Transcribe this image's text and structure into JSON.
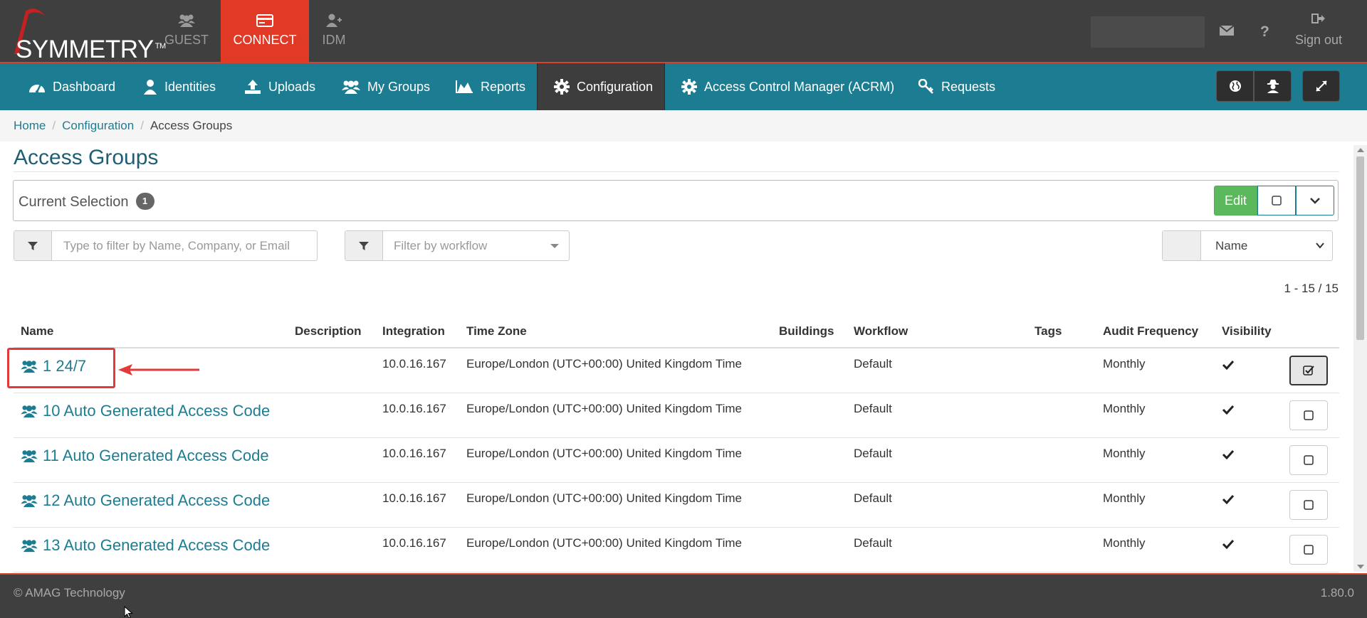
{
  "brand": {
    "name": "SYMMETRY",
    "tm": "TM"
  },
  "app_tabs": [
    {
      "label": "GUEST",
      "icon": "users-icon",
      "active": false
    },
    {
      "label": "CONNECT",
      "icon": "id-card-icon",
      "active": true
    },
    {
      "label": "IDM",
      "icon": "user-plus-icon",
      "active": false
    }
  ],
  "topbar": {
    "sign_out": "Sign out"
  },
  "nav": {
    "items": [
      {
        "label": "Dashboard",
        "icon": "tachometer-icon"
      },
      {
        "label": "Identities",
        "icon": "user-icon"
      },
      {
        "label": "Uploads",
        "icon": "upload-icon"
      },
      {
        "label": "My Groups",
        "icon": "users-icon"
      },
      {
        "label": "Reports",
        "icon": "area-chart-icon"
      },
      {
        "label": "Configuration",
        "icon": "gear-icon",
        "active": true
      },
      {
        "label": "Access Control Manager (ACRM)",
        "icon": "gear-icon"
      },
      {
        "label": "Requests",
        "icon": "key-icon"
      }
    ]
  },
  "breadcrumb": {
    "home": "Home",
    "config": "Configuration",
    "current": "Access Groups"
  },
  "page": {
    "title": "Access Groups"
  },
  "selection": {
    "label": "Current Selection",
    "count": "1",
    "edit": "Edit"
  },
  "filters": {
    "search_placeholder": "Type to filter by Name, Company, or Email",
    "workflow_placeholder": "Filter by workflow",
    "sort_value": "Name"
  },
  "pagination": "1 - 15 / 15",
  "table": {
    "headers": {
      "name": "Name",
      "description": "Description",
      "integration": "Integration",
      "timezone": "Time Zone",
      "buildings": "Buildings",
      "workflow": "Workflow",
      "tags": "Tags",
      "audit": "Audit Frequency",
      "visibility": "Visibility"
    },
    "rows": [
      {
        "name": "1 24/7",
        "integration": "10.0.16.167",
        "timezone": "Europe/London (UTC+00:00) United Kingdom Time",
        "workflow": "Default",
        "audit": "Monthly",
        "selected": true
      },
      {
        "name": "10 Auto Generated Access Code",
        "integration": "10.0.16.167",
        "timezone": "Europe/London (UTC+00:00) United Kingdom Time",
        "workflow": "Default",
        "audit": "Monthly",
        "selected": false
      },
      {
        "name": "11 Auto Generated Access Code",
        "integration": "10.0.16.167",
        "timezone": "Europe/London (UTC+00:00) United Kingdom Time",
        "workflow": "Default",
        "audit": "Monthly",
        "selected": false
      },
      {
        "name": "12 Auto Generated Access Code",
        "integration": "10.0.16.167",
        "timezone": "Europe/London (UTC+00:00) United Kingdom Time",
        "workflow": "Default",
        "audit": "Monthly",
        "selected": false
      },
      {
        "name": "13 Auto Generated Access Code",
        "integration": "10.0.16.167",
        "timezone": "Europe/London (UTC+00:00) United Kingdom Time",
        "workflow": "Default",
        "audit": "Monthly",
        "selected": false
      }
    ]
  },
  "footer": {
    "copyright": "© AMAG Technology",
    "version": "1.80.0"
  },
  "colors": {
    "topbar": "#3f3f3f",
    "accent_red": "#e03a27",
    "nav_teal": "#1c7d92",
    "link": "#1c7d92",
    "edit_green": "#5cb85c",
    "annotation_red": "#e03a3a"
  }
}
